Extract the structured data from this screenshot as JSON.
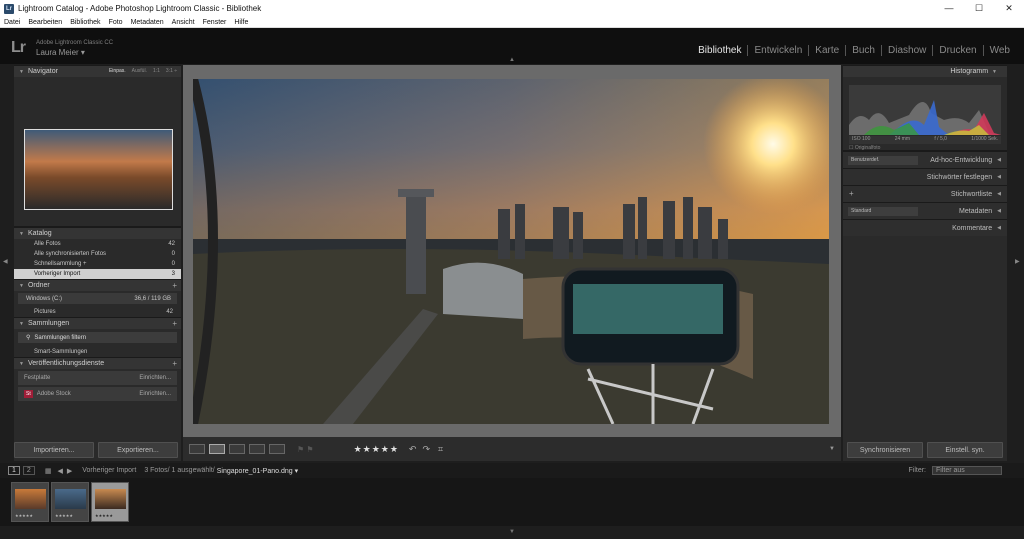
{
  "window": {
    "title": "Lightroom Catalog - Adobe Photoshop Lightroom Classic - Bibliothek",
    "min": "—",
    "max": "☐",
    "close": "✕"
  },
  "menu": [
    "Datei",
    "Bearbeiten",
    "Bibliothek",
    "Foto",
    "Metadaten",
    "Ansicht",
    "Fenster",
    "Hilfe"
  ],
  "identity": {
    "logo": "Lr",
    "app": "Adobe Lightroom Classic CC",
    "user": "Laura Meier ▾"
  },
  "modules": [
    "Bibliothek",
    "Entwickeln",
    "Karte",
    "Buch",
    "Diashow",
    "Drucken",
    "Web"
  ],
  "navigator": {
    "title": "Navigator",
    "options": [
      "Einpas.",
      "Ausfül.",
      "1:1",
      "3:1 ÷"
    ]
  },
  "catalog": {
    "title": "Katalog",
    "rows": [
      {
        "label": "Alle Fotos",
        "count": "42"
      },
      {
        "label": "Alle synchronisierten Fotos",
        "count": "0"
      },
      {
        "label": "Schnellsammlung +",
        "count": "0"
      },
      {
        "label": "Vorheriger Import",
        "count": "3"
      }
    ]
  },
  "folders": {
    "title": "Ordner",
    "volume": "Windows (C:)",
    "volume_info": "36,6 / 119 GB",
    "pictures": "Pictures",
    "pictures_count": "42"
  },
  "collections": {
    "title": "Sammlungen",
    "filter": "Sammlungen filtern",
    "smart": "Smart-Sammlungen"
  },
  "publish": {
    "title": "Veröffentlichungsdienste",
    "rows": [
      {
        "label": "Festplatte",
        "action": "Einrichten..."
      },
      {
        "label": "Adobe Stock",
        "action": "Einrichten...",
        "badge": "St"
      }
    ]
  },
  "left_buttons": {
    "import": "Importieren...",
    "export": "Exportieren..."
  },
  "right_buttons": {
    "sync_meta": "Synchronisieren",
    "sync_settings": "Einstell. syn."
  },
  "histogram": {
    "title": "Histogramm",
    "iso": "ISO 100",
    "focal": "24 mm",
    "aperture": "f / 5,0",
    "shutter": "1/1000 Sek.",
    "original": "Originalfoto"
  },
  "right_sections": [
    {
      "label": "Ad-hoc-Entwicklung",
      "dropdown": "Benutzerdef."
    },
    {
      "label": "Stichwörter festlegen"
    },
    {
      "label": "Stichwortliste",
      "plus": "+"
    },
    {
      "label": "Metadaten",
      "dropdown": "Standard"
    },
    {
      "label": "Kommentare"
    }
  ],
  "toolbar": {
    "stars": "★★★★★"
  },
  "filmstrip": {
    "page1": "1",
    "page2": "2",
    "source": "Vorheriger Import",
    "info": "3 Fotos/ 1 ausgewählt/",
    "file": "Singapore_01-Pano.dng ▾",
    "filter_label": "Filter:",
    "filter_value": "Filter aus",
    "thumb_stars": "★★★★★"
  }
}
